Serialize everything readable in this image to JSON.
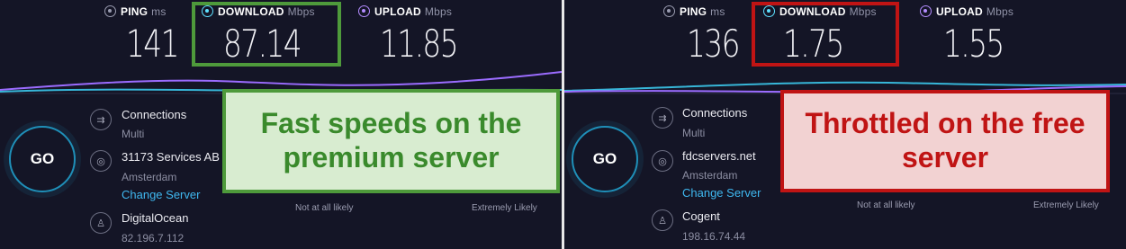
{
  "colors": {
    "background": "#141526",
    "download_icon": "#5ee0ff",
    "upload_icon": "#b48cff",
    "link": "#3fb8f0",
    "highlight_good": "#4e9a3b",
    "highlight_bad": "#c01414"
  },
  "left": {
    "ping": {
      "label": "PING",
      "unit": "ms",
      "value": "141",
      "icon": "ping-icon"
    },
    "download": {
      "label": "DOWNLOAD",
      "unit": "Mbps",
      "value": "87.14",
      "icon": "download-icon"
    },
    "upload": {
      "label": "UPLOAD",
      "unit": "Mbps",
      "value": "11.85",
      "icon": "upload-icon"
    },
    "go_label": "GO",
    "connections": {
      "title": "Connections",
      "value": "Multi",
      "icon": "connections-icon"
    },
    "server": {
      "name": "31173 Services AB",
      "location": "Amsterdam",
      "change": "Change Server",
      "icon": "globe-icon"
    },
    "provider": {
      "name": "DigitalOcean",
      "ip": "82.196.7.112",
      "icon": "user-icon"
    },
    "likely_low": "Not at all likely",
    "likely_high": "Extremely Likely",
    "overlay": [
      "Fast speeds on the",
      "premium server"
    ]
  },
  "right": {
    "ping": {
      "label": "PING",
      "unit": "ms",
      "value": "136",
      "icon": "ping-icon"
    },
    "download": {
      "label": "DOWNLOAD",
      "unit": "Mbps",
      "value": "1.75",
      "icon": "download-icon"
    },
    "upload": {
      "label": "UPLOAD",
      "unit": "Mbps",
      "value": "1.55",
      "icon": "upload-icon"
    },
    "go_label": "GO",
    "connections": {
      "title": "Connections",
      "value": "Multi",
      "icon": "connections-icon"
    },
    "server": {
      "name": "fdcservers.net",
      "location": "Amsterdam",
      "change": "Change Server",
      "icon": "globe-icon"
    },
    "provider": {
      "name": "Cogent",
      "ip": "198.16.74.44",
      "icon": "user-icon"
    },
    "likely_low": "Not at all likely",
    "likely_high": "Extremely Likely",
    "overlay": [
      "Throttled on the free",
      "server"
    ]
  }
}
